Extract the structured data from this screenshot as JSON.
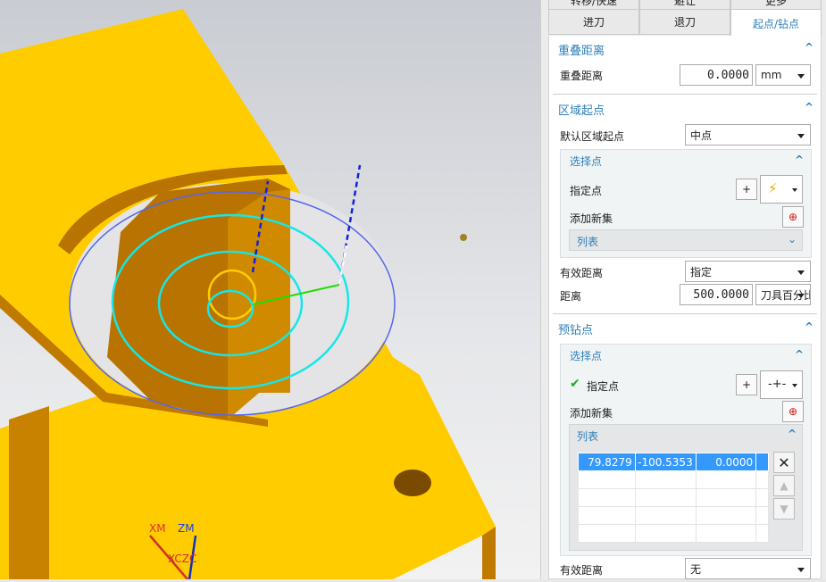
{
  "viewport": {
    "axis_labels": {
      "xm": "XM",
      "zm": "ZM",
      "xczc": "XCZC"
    },
    "colors": {
      "part": "#ffcc00",
      "wall": "#b87300",
      "cyan": "#17e6e6",
      "blue_circle": "#5566ee",
      "green": "#22dd00"
    }
  },
  "panel": {
    "tabs_row1": [
      "转移/快速",
      "避让",
      "更多"
    ],
    "tabs_row2": [
      "进刀",
      "退刀",
      "起点/钻点"
    ],
    "active_tab": "起点/钻点",
    "overlap": {
      "title": "重叠距离",
      "label": "重叠距离",
      "value": "0.0000",
      "unit": "mm"
    },
    "region_start": {
      "title": "区域起点",
      "default_label": "默认区域起点",
      "default_value": "中点",
      "select_point": {
        "title": "选择点",
        "specify_label": "指定点",
        "add_set_label": "添加新集",
        "list_label": "列表"
      },
      "valid_distance_label": "有效距离",
      "valid_distance_value": "指定",
      "distance_label": "距离",
      "distance_value": "500.0000",
      "distance_unit": "刀具百分比"
    },
    "predrill": {
      "title": "预钻点",
      "select_point": {
        "title": "选择点",
        "specify_label": "指定点",
        "add_set_label": "添加新集",
        "list_label": "列表",
        "rows": [
          [
            "79.8279",
            "-100.5353",
            "0.0000",
            ""
          ],
          [
            "",
            "",
            "",
            ""
          ],
          [
            "",
            "",
            "",
            ""
          ],
          [
            "",
            "",
            "",
            ""
          ],
          [
            "",
            "",
            "",
            ""
          ]
        ]
      },
      "valid_distance_label": "有效距离",
      "valid_distance_value": "无"
    },
    "accent": "#2f7fb8"
  }
}
